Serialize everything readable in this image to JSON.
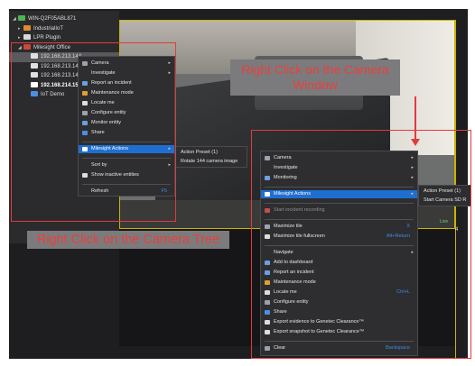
{
  "tree": {
    "items": [
      {
        "label": "WIN-Q2F05ABL871",
        "color": "#4fb54f"
      },
      {
        "label": "IndustrialIoT",
        "color": "#e08a2a"
      },
      {
        "label": "LPR Plugin",
        "color": "#d8d8d8"
      },
      {
        "label": "Milesight Office",
        "color": "#c84a3a"
      },
      {
        "label": "192.168.213.144 -",
        "color": "#e0e0e0"
      },
      {
        "label": "192.168.213.146 -",
        "color": "#e0e0e0"
      },
      {
        "label": "192.168.213.148 -",
        "color": "#e0e0e0"
      },
      {
        "label": "192.168.214.153 -",
        "color": "#ffffff"
      },
      {
        "label": "IoT Demo",
        "color": "#4a8fe0"
      }
    ]
  },
  "tree_menu": {
    "items": [
      {
        "label": "Camera",
        "shortcut": "",
        "submenu": true,
        "icon": "camera-icon",
        "color": "#9aa3ad"
      },
      {
        "label": "Investigate",
        "shortcut": "",
        "submenu": true,
        "icon": "",
        "color": ""
      },
      {
        "label": "Report an incident",
        "shortcut": "",
        "submenu": false,
        "icon": "report-icon",
        "color": "#6aa0e0"
      },
      {
        "label": "Maintenance mode",
        "shortcut": "",
        "submenu": false,
        "icon": "maintenance-icon",
        "color": "#e0a030"
      },
      {
        "label": "Locate me",
        "shortcut": "",
        "submenu": false,
        "icon": "locate-icon",
        "color": "#dddddd"
      },
      {
        "label": "Configure entity",
        "shortcut": "",
        "submenu": false,
        "icon": "configure-icon",
        "color": "#9aa3ad"
      },
      {
        "label": "Monitor entity",
        "shortcut": "",
        "submenu": false,
        "icon": "monitor-icon",
        "color": "#6aa0e0"
      },
      {
        "label": "Share",
        "shortcut": "",
        "submenu": false,
        "icon": "share-icon",
        "color": "#4a90e0"
      },
      {
        "label": "Milesight Actions",
        "shortcut": "",
        "submenu": true,
        "icon": "milesight-icon",
        "color": "#ffffff",
        "highlighted": true
      },
      {
        "label": "Sort by",
        "shortcut": "",
        "submenu": true,
        "icon": "",
        "color": ""
      },
      {
        "label": "Show inactive entities",
        "shortcut": "",
        "submenu": false,
        "icon": "check-icon",
        "color": "#dddddd"
      },
      {
        "label": "Refresh",
        "shortcut": "F5",
        "submenu": false,
        "icon": "",
        "color": ""
      }
    ],
    "submenu": [
      "Action Preset (1)",
      "Rotate 144 camera image"
    ]
  },
  "tile_menu": {
    "items": [
      {
        "label": "Camera",
        "shortcut": "",
        "submenu": true,
        "icon": "camera-icon",
        "color": "#9aa3ad"
      },
      {
        "label": "Investigate",
        "shortcut": "",
        "submenu": true,
        "icon": "",
        "color": ""
      },
      {
        "label": "Monitoring",
        "shortcut": "",
        "submenu": true,
        "icon": "monitoring-icon",
        "color": "#6aa0e0"
      },
      {
        "label": "Milesight Actions",
        "shortcut": "",
        "submenu": true,
        "icon": "milesight-icon",
        "color": "#ffffff",
        "highlighted": true
      },
      {
        "label": "Start incident recording",
        "shortcut": "",
        "submenu": false,
        "icon": "record-icon",
        "color": "#c0504d",
        "disabled": true
      },
      {
        "label": "Maximize tile",
        "shortcut": "X",
        "submenu": false,
        "icon": "maximize-icon",
        "color": "#9aa3ad"
      },
      {
        "label": "Maximize tile fullscreen",
        "shortcut": "Alt+Return",
        "submenu": false,
        "icon": "fullscreen-icon",
        "color": "#dddddd"
      },
      {
        "label": "Navigate",
        "shortcut": "",
        "submenu": true,
        "icon": "",
        "color": ""
      },
      {
        "label": "Add to dashboard",
        "shortcut": "",
        "submenu": false,
        "icon": "dashboard-icon",
        "color": "#6aa0e0"
      },
      {
        "label": "Report an incident",
        "shortcut": "",
        "submenu": false,
        "icon": "report-icon",
        "color": "#6aa0e0"
      },
      {
        "label": "Maintenance mode",
        "shortcut": "",
        "submenu": false,
        "icon": "maintenance-icon",
        "color": "#e0a030"
      },
      {
        "label": "Locate me",
        "shortcut": "Ctrl+L",
        "submenu": false,
        "icon": "locate-icon",
        "color": "#dddddd"
      },
      {
        "label": "Configure entity",
        "shortcut": "",
        "submenu": false,
        "icon": "configure-icon",
        "color": "#9aa3ad"
      },
      {
        "label": "Share",
        "shortcut": "",
        "submenu": false,
        "icon": "share-icon",
        "color": "#4a90e0"
      },
      {
        "label": "Export evidence to Genetec Clearance™",
        "shortcut": "",
        "submenu": false,
        "icon": "export-icon",
        "color": "#dddddd"
      },
      {
        "label": "Export snapshot to Genetec Clearance™",
        "shortcut": "",
        "submenu": false,
        "icon": "export-icon",
        "color": "#dddddd"
      },
      {
        "label": "Clear",
        "shortcut": "Backspace",
        "submenu": false,
        "icon": "clear-icon",
        "color": "#9aa3ad"
      }
    ],
    "submenu": [
      "Action Preset (1)",
      "Start Camera SD R"
    ]
  },
  "tile": {
    "number": "4",
    "live": "Live"
  },
  "callouts": {
    "camera": "Right Click on the Camera Window",
    "tree": "Right Click on the Camera Tree"
  },
  "colors": {
    "highlight": "#1f6fd1",
    "annotation": "#e23b3b",
    "menu_bg": "#2e2e30"
  }
}
